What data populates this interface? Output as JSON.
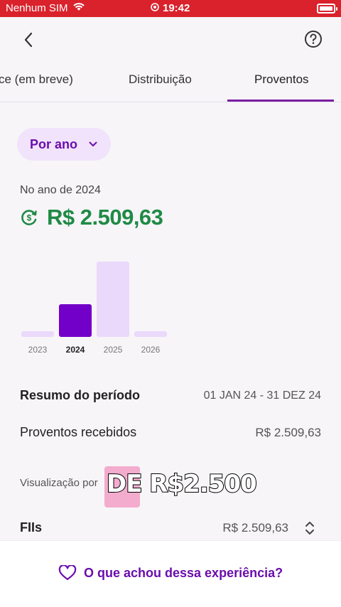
{
  "status_bar": {
    "carrier": "Nenhum SIM",
    "time": "19:42"
  },
  "nav": {
    "back_icon": "chevron-left-icon",
    "help_icon": "question-circle-icon"
  },
  "tabs": [
    {
      "label": "ce (em breve)",
      "selected": false
    },
    {
      "label": "Distribuição",
      "selected": false
    },
    {
      "label": "Proventos",
      "selected": true
    }
  ],
  "filter": {
    "label": "Por ano",
    "icon": "chevron-down-icon"
  },
  "summary": {
    "year_label": "No ano de 2024",
    "total": "R$ 2.509,63",
    "total_icon": "dollar-cycle-icon",
    "total_color": "#1f8a45"
  },
  "chart_data": {
    "type": "bar",
    "categories": [
      "2023",
      "2024",
      "2025",
      "2026"
    ],
    "values": [
      0,
      2509.63,
      5800,
      0
    ],
    "selected": "2024",
    "colors": {
      "default": "#ead9fb",
      "selected": "#7200c9"
    }
  },
  "period": {
    "label": "Resumo do período",
    "range": "01 JAN 24 - 31 DEZ 24"
  },
  "received": {
    "label": "Proventos recebidos",
    "value": "R$ 2.509,63"
  },
  "breakdown": {
    "subtitle": "Visualização por",
    "fiis_label": "FIIs",
    "fiis_value": "R$ 2.509,63",
    "sort_icon": "sort-updown-icon"
  },
  "overlay": {
    "caption": "DE R$2.500"
  },
  "feedback": {
    "label": "O que achou dessa experiência?",
    "icon": "heart-icon"
  },
  "colors": {
    "accent": "#6a0dad",
    "status_bar": "#d9222c"
  }
}
